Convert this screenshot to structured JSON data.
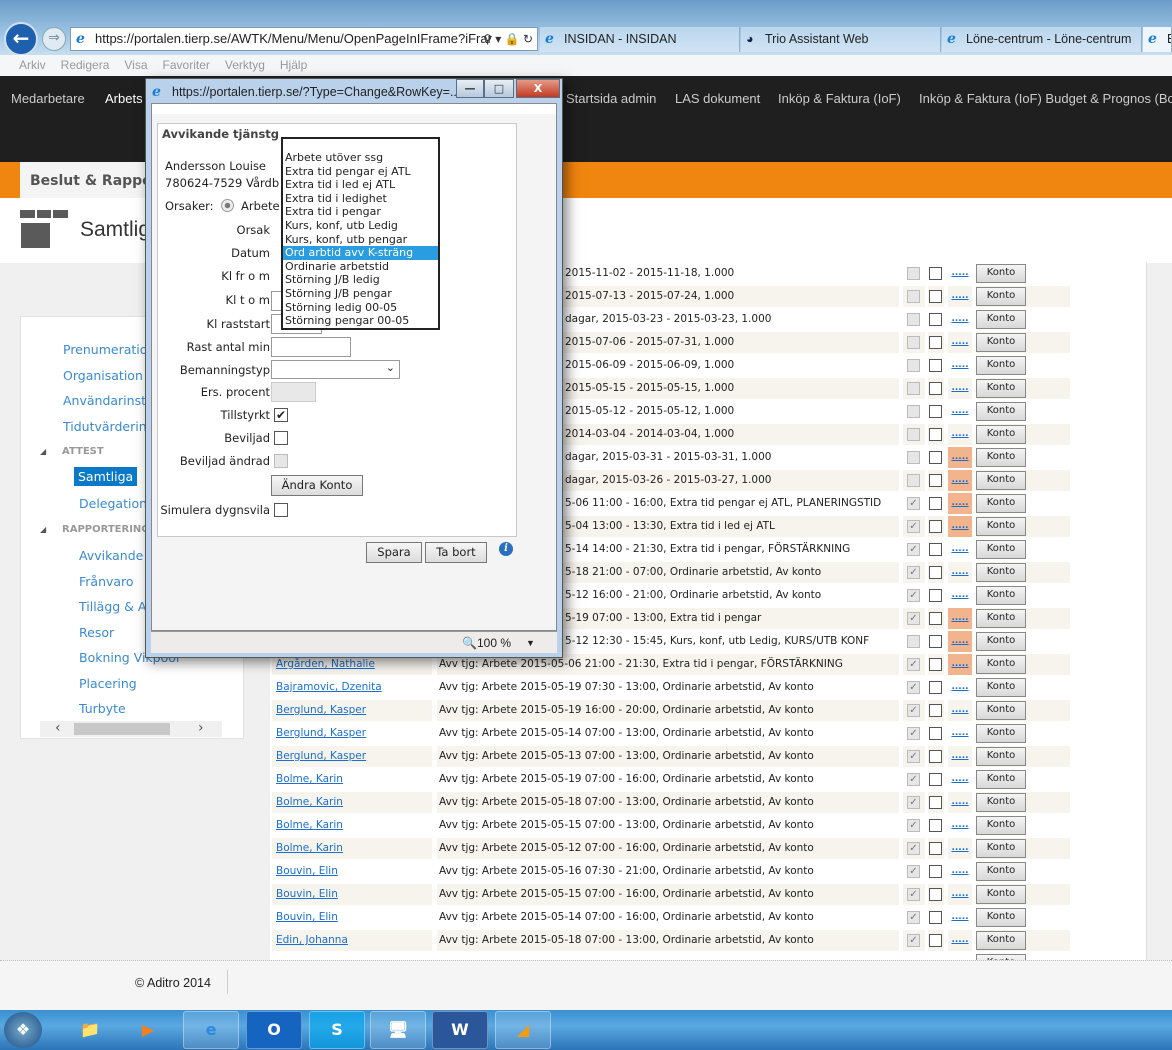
{
  "browser": {
    "address": "https://portalen.tierp.se/AWTK/Menu/Menu/OpenPageInIFrame?iFrar",
    "tabs": [
      "INSIDAN - INSIDAN",
      "Trio Assistant Web",
      "Löne-centrum - Löne-centrum",
      "B"
    ],
    "menu": [
      "Arkiv",
      "Redigera",
      "Visa",
      "Favoriter",
      "Verktyg",
      "Hjälp"
    ]
  },
  "nav": {
    "items": [
      "Medarbetare",
      "Arbets",
      "Startsida admin",
      "LAS dokument",
      "Inköp & Faktura (IoF)",
      "Inköp & Faktura (IoF) Budget & Prognos (Bo"
    ]
  },
  "section": {
    "title": "Beslut & Rappo"
  },
  "page": {
    "title": "Samtlig"
  },
  "sidebar": {
    "items": [
      "Prenumeration",
      "Organisation",
      "Användarinstä",
      "Tidutvärdering"
    ],
    "attest_header": "ATTEST",
    "attest_items": [
      "Samtliga",
      "Delegation"
    ],
    "rapport_header": "RAPPORTERING",
    "rapport_items": [
      "Avvikande t",
      "Frånvaro",
      "Tillägg & A",
      "Resor",
      "Bokning Vikpool",
      "Placering",
      "Turbyte"
    ],
    "active": "Samtliga"
  },
  "table": {
    "konto_label": "Konto",
    "dots_label": ".....",
    "rows": [
      {
        "name": "",
        "desc": "2015-11-02 - 2015-11-18, 1.000",
        "hidden": true,
        "approved": false,
        "granted": false,
        "warn": false
      },
      {
        "name": "",
        "desc": "2015-07-13 - 2015-07-24, 1.000",
        "hidden": true,
        "approved": false,
        "granted": false,
        "warn": false
      },
      {
        "name": "",
        "desc": "dagar, 2015-03-23 - 2015-03-23, 1.000",
        "hidden": true,
        "approved": false,
        "granted": false,
        "warn": false
      },
      {
        "name": "",
        "desc": "2015-07-06 - 2015-07-31, 1.000",
        "hidden": true,
        "approved": false,
        "granted": false,
        "warn": false
      },
      {
        "name": "",
        "desc": "2015-06-09 - 2015-06-09, 1.000",
        "hidden": true,
        "approved": false,
        "granted": false,
        "warn": false
      },
      {
        "name": "",
        "desc": "2015-05-15 - 2015-05-15, 1.000",
        "hidden": true,
        "approved": false,
        "granted": false,
        "warn": false
      },
      {
        "name": "",
        "desc": "2015-05-12 - 2015-05-12, 1.000",
        "hidden": true,
        "approved": false,
        "granted": false,
        "warn": false
      },
      {
        "name": "",
        "desc": "2014-03-04 - 2014-03-04, 1.000",
        "hidden": true,
        "approved": false,
        "granted": false,
        "warn": false
      },
      {
        "name": "",
        "desc": "dagar, 2015-03-31 - 2015-03-31, 1.000",
        "hidden": true,
        "approved": false,
        "granted": false,
        "warn": true
      },
      {
        "name": "",
        "desc": "dagar, 2015-03-26 - 2015-03-27, 1.000",
        "hidden": true,
        "approved": false,
        "granted": false,
        "warn": true
      },
      {
        "name": "",
        "desc": "5-06 11:00 - 16:00, Extra tid pengar ej ATL, PLANERINGSTID",
        "hidden": true,
        "approved": true,
        "granted": false,
        "warn": true
      },
      {
        "name": "",
        "desc": "5-04 13:00 - 13:30, Extra tid i led ej ATL",
        "hidden": true,
        "approved": true,
        "granted": false,
        "warn": true
      },
      {
        "name": "",
        "desc": "5-14 14:00 - 21:30, Extra tid i pengar, FÖRSTÄRKNING",
        "hidden": true,
        "approved": true,
        "granted": false,
        "warn": false
      },
      {
        "name": "",
        "desc": "5-18 21:00 - 07:00, Ordinarie arbetstid, Av konto",
        "hidden": true,
        "approved": true,
        "granted": false,
        "warn": false
      },
      {
        "name": "",
        "desc": "5-12 16:00 - 21:00, Ordinarie arbetstid, Av konto",
        "hidden": true,
        "approved": true,
        "granted": false,
        "warn": false
      },
      {
        "name": "",
        "desc": "5-19 07:00 - 13:00, Extra tid i pengar",
        "hidden": true,
        "approved": true,
        "granted": false,
        "warn": true
      },
      {
        "name": "",
        "desc": "5-12 12:30 - 15:45, Kurs, konf, utb Ledig, KURS/UTB KONF",
        "hidden": true,
        "approved": false,
        "granted": false,
        "warn": true
      },
      {
        "name": "Argården, Nathalie",
        "desc": "Avv tjg: Arbete 2015-05-06 21:00 - 21:30, Extra tid i pengar, FÖRSTÄRKNING",
        "hidden": false,
        "approved": true,
        "granted": false,
        "warn": true
      },
      {
        "name": "Bajramovic, Dzenita",
        "desc": "Avv tjg: Arbete 2015-05-19 07:30 - 13:00, Ordinarie arbetstid, Av konto",
        "hidden": false,
        "approved": true,
        "granted": false,
        "warn": false
      },
      {
        "name": "Berglund, Kasper",
        "desc": "Avv tjg: Arbete 2015-05-19 16:00 - 20:00, Ordinarie arbetstid, Av konto",
        "hidden": false,
        "approved": true,
        "granted": false,
        "warn": false
      },
      {
        "name": "Berglund, Kasper",
        "desc": "Avv tjg: Arbete 2015-05-14 07:00 - 13:00, Ordinarie arbetstid, Av konto",
        "hidden": false,
        "approved": true,
        "granted": false,
        "warn": false
      },
      {
        "name": "Berglund, Kasper",
        "desc": "Avv tjg: Arbete 2015-05-13 07:00 - 13:00, Ordinarie arbetstid, Av konto",
        "hidden": false,
        "approved": true,
        "granted": false,
        "warn": false
      },
      {
        "name": "Bolme, Karin",
        "desc": "Avv tjg: Arbete 2015-05-19 07:00 - 16:00, Ordinarie arbetstid, Av konto",
        "hidden": false,
        "approved": true,
        "granted": false,
        "warn": false
      },
      {
        "name": "Bolme, Karin",
        "desc": "Avv tjg: Arbete 2015-05-18 07:00 - 13:00, Ordinarie arbetstid, Av konto",
        "hidden": false,
        "approved": true,
        "granted": false,
        "warn": false
      },
      {
        "name": "Bolme, Karin",
        "desc": "Avv tjg: Arbete 2015-05-15 07:00 - 13:00, Ordinarie arbetstid, Av konto",
        "hidden": false,
        "approved": true,
        "granted": false,
        "warn": false
      },
      {
        "name": "Bolme, Karin",
        "desc": "Avv tjg: Arbete 2015-05-12 07:00 - 16:00, Ordinarie arbetstid, Av konto",
        "hidden": false,
        "approved": true,
        "granted": false,
        "warn": false
      },
      {
        "name": "Bouvin, Elin",
        "desc": "Avv tjg: Arbete 2015-05-16 07:30 - 21:00, Ordinarie arbetstid, Av konto",
        "hidden": false,
        "approved": true,
        "granted": false,
        "warn": false
      },
      {
        "name": "Bouvin, Elin",
        "desc": "Avv tjg: Arbete 2015-05-15 07:00 - 16:00, Ordinarie arbetstid, Av konto",
        "hidden": false,
        "approved": true,
        "granted": false,
        "warn": false
      },
      {
        "name": "Bouvin, Elin",
        "desc": "Avv tjg: Arbete 2015-05-14 07:00 - 16:00, Ordinarie arbetstid, Av konto",
        "hidden": false,
        "approved": true,
        "granted": false,
        "warn": false
      },
      {
        "name": "Edin, Johanna",
        "desc": "Avv tjg: Arbete 2015-05-18 07:00 - 13:00, Ordinarie arbetstid, Av konto",
        "hidden": false,
        "approved": true,
        "granted": false,
        "warn": false
      }
    ]
  },
  "popup": {
    "title": "https://portalen.tierp.se/?Type=Change&RowKey=...",
    "heading": "Avvikande tjänstg",
    "person_name": "Andersson Louise",
    "person_id": "780624-7529 Vårdb",
    "orsaker_label": "Orsaker:",
    "orsaker_value": "Arbete",
    "labels": {
      "orsak": "Orsak",
      "datum": "Datum",
      "kl_from": "Kl fr o m",
      "kl_tom": "Kl t o m",
      "raststart": "Kl raststart",
      "rast_min": "Rast antal min",
      "bemanning": "Bemanningstyp",
      "ers": "Ers. procent",
      "tillstyrkt": "Tillstyrkt",
      "beviljad": "Beviljad",
      "beviljad_andrad": "Beviljad ändrad",
      "simulera": "Simulera dygnsvila"
    },
    "tillstyrkt": true,
    "beviljad": false,
    "simulera": false,
    "andra_konto": "Ändra Konto",
    "spara": "Spara",
    "ta_bort": "Ta bort",
    "zoom": "100 %",
    "orsak_options": [
      "Arbete utöver ssg",
      "Extra tid pengar ej ATL",
      "Extra tid i led ej ATL",
      "Extra tid i ledighet",
      "Extra tid i pengar",
      "Kurs, konf, utb Ledig",
      "Kurs, konf, utb pengar",
      "Ord arbtid avv K-sträng",
      "Ordinarie arbetstid",
      "Störning J/B ledig",
      "Störning J/B pengar",
      "Störning ledig 00-05",
      "Störning pengar 00-05"
    ],
    "orsak_selected": "Ord arbtid avv K-sträng"
  },
  "footer": {
    "copyright": "© Aditro 2014"
  },
  "colors": {
    "accent": "#f0850f",
    "nav": "#1f1f1f",
    "active": "#0a7ac8",
    "warn": "#f2b48c",
    "link": "#1a6fd0"
  }
}
